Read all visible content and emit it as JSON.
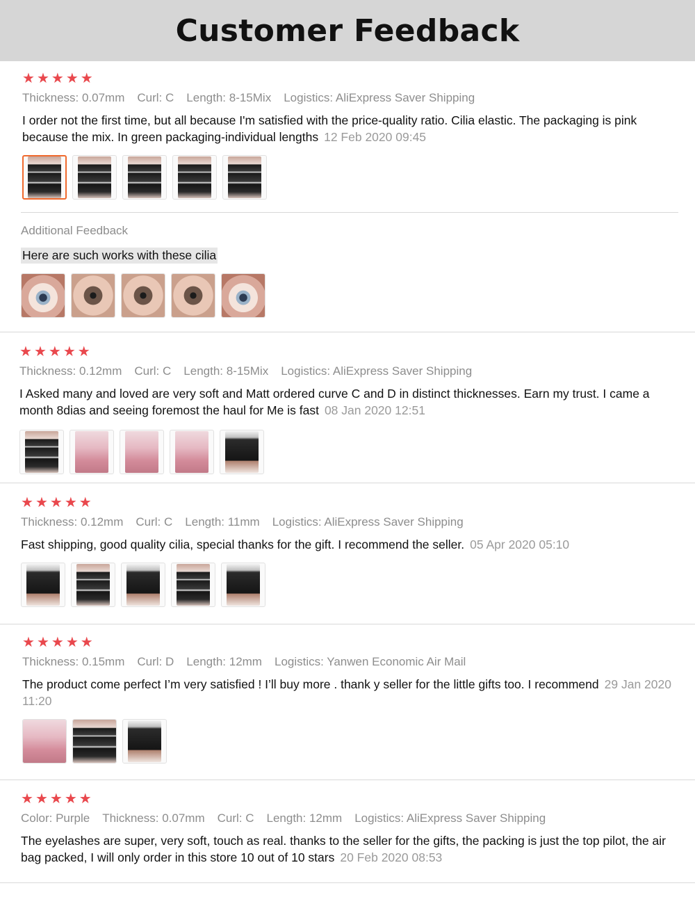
{
  "header": {
    "title": "Customer Feedback"
  },
  "colors": {
    "star": "#e9484d",
    "header_bg": "#d6d6d6",
    "meta": "#8d8d8d",
    "active_thumb_border": "#f06a2e"
  },
  "reviews": [
    {
      "rating": 5,
      "meta": [
        "Thickness: 0.07mm",
        "Curl: C",
        "Length: 8-15Mix",
        "Logistics: AliExpress Saver Shipping"
      ],
      "text": "I order not the first time, but all because I'm satisfied with the price-quality ratio. Cilia elastic. The packaging is pink because the mix. In green packaging-individual lengths",
      "date": "12 Feb 2020 09:45",
      "photos": [
        "lash-box-photo",
        "lash-box-photo",
        "lash-box-photo",
        "lash-box-photo",
        "lash-box-photo"
      ],
      "additional": {
        "label": "Additional Feedback",
        "text": "Here are such works with these cilia",
        "photos": [
          "eye-photo",
          "eye-photo",
          "eye-photo",
          "eye-photo",
          "eye-photo"
        ]
      }
    },
    {
      "rating": 5,
      "meta": [
        "Thickness: 0.12mm",
        "Curl: C",
        "Length: 8-15Mix",
        "Logistics: AliExpress Saver Shipping"
      ],
      "text": "I Asked many and loved are very soft and Matt ordered curve C and D in distinct thicknesses. Earn my trust. I came a month 8dias and seeing foremost the haul for Me is fast",
      "date": "08 Jan 2020 12:51",
      "photos": [
        "lash-box-photo",
        "pink-box-photo",
        "pink-box-photo",
        "pink-box-photo",
        "lash-box-photo"
      ]
    },
    {
      "rating": 5,
      "meta": [
        "Thickness: 0.12mm",
        "Curl: C",
        "Length: 11mm",
        "Logistics: AliExpress Saver Shipping"
      ],
      "text": "Fast shipping, good quality cilia, special thanks for the gift. I recommend the seller.",
      "date": "05 Apr 2020 05:10",
      "photos": [
        "lash-box-photo",
        "lash-box-photo",
        "lash-box-photo",
        "lash-box-photo",
        "lash-box-photo"
      ]
    },
    {
      "rating": 5,
      "meta": [
        "Thickness: 0.15mm",
        "Curl: D",
        "Length: 12mm",
        "Logistics: Yanwen Economic Air Mail"
      ],
      "text": "The product come perfect I’m very satisfied ! I’ll buy more . thank y seller for the little gifts too. I recommend",
      "date": "29 Jan 2020 11:20",
      "photos": [
        "package-photo",
        "package-photo",
        "lash-box-photo"
      ]
    },
    {
      "rating": 5,
      "meta": [
        "Color: Purple",
        "Thickness: 0.07mm",
        "Curl: C",
        "Length: 12mm",
        "Logistics: AliExpress Saver Shipping"
      ],
      "text": "The eyelashes are super, very soft, touch as real. thanks to the seller for the gifts, the packing is just the top pilot, the air bag packed, I will only order in this store 10 out of 10 stars",
      "date": "20 Feb 2020 08:53",
      "photos": []
    }
  ]
}
